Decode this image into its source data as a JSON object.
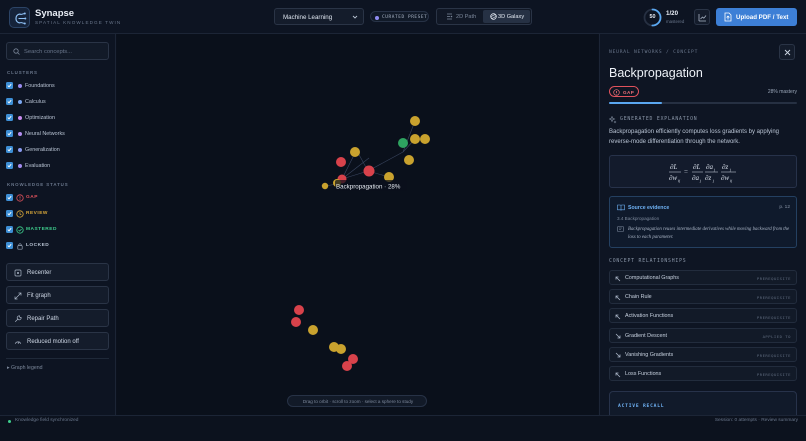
{
  "app": {
    "name": "Synapse",
    "subtitle": "SPATIAL KNOWLEDGE TWIN"
  },
  "header": {
    "dataset_select": "Machine Learning",
    "preset_badge": "CURATED PRESET",
    "view_2d": "2D Path",
    "view_3d": "3D Galaxy",
    "active_view": "3D Galaxy",
    "mastery_ring_value": "50",
    "mastery_ring_fraction": 0.5,
    "progress_count": "1/20",
    "progress_label": "mastered",
    "upload_label": "Upload PDF / Text"
  },
  "sidebar": {
    "search_placeholder": "Search concepts...",
    "clusters_title": "CLUSTERS",
    "clusters": [
      {
        "label": "Foundations",
        "color": "#9a8cf0"
      },
      {
        "label": "Calculus",
        "color": "#7aa7f2"
      },
      {
        "label": "Optimization",
        "color": "#c98cf0"
      },
      {
        "label": "Neural Networks",
        "color": "#b48ef0"
      },
      {
        "label": "Generalization",
        "color": "#8a9af0"
      },
      {
        "label": "Evaluation",
        "color": "#a38cf0"
      }
    ],
    "status_title": "KNOWLEDGE STATUS",
    "statuses": [
      {
        "label": "GAP",
        "color": "#e0525c"
      },
      {
        "label": "REVIEW",
        "color": "#d9a83a"
      },
      {
        "label": "MASTERED",
        "color": "#3ecf8e"
      },
      {
        "label": "LOCKED",
        "color": "#9aa6b8"
      }
    ],
    "actions": [
      {
        "label": "Recenter",
        "icon": "crosshair-icon"
      },
      {
        "label": "Fit graph",
        "icon": "expand-icon"
      },
      {
        "label": "Repair Path",
        "icon": "wrench-icon"
      },
      {
        "label": "Reduced motion off",
        "icon": "motion-icon"
      }
    ],
    "legend_toggle": "▸ Graph legend"
  },
  "graph": {
    "selected_label": "Backpropagation · 28%",
    "hint": "Drag to orbit · scroll to zoom · select a sphere to study",
    "node_colors": {
      "gap": "#d8424b",
      "review": "#c9a22e",
      "mastered": "#2ea360"
    }
  },
  "panel": {
    "breadcrumb": "NEURAL NETWORKS  /  CONCEPT",
    "title": "Backpropagation",
    "status_badge": "GAP",
    "mastery_text": "28% mastery",
    "mastery_fraction": 0.28,
    "generated_title": "GENERATED EXPLANATION",
    "explanation": "Backpropagation efficiently computes loss gradients by applying reverse-mode differentiation through the network.",
    "evidence": {
      "title": "Source evidence",
      "page": "p. 12",
      "section": "3.4 Backpropagation",
      "quote": "Backpropagation reuses intermediate derivatives while moving backward from the loss to each parameter."
    },
    "relationships_title": "CONCEPT RELATIONSHIPS",
    "relationships": [
      {
        "name": "Computational Graphs",
        "type": "PREREQUISITE",
        "dir": "in"
      },
      {
        "name": "Chain Rule",
        "type": "PREREQUISITE",
        "dir": "in"
      },
      {
        "name": "Activation Functions",
        "type": "PREREQUISITE",
        "dir": "in"
      },
      {
        "name": "Gradient Descent",
        "type": "APPLIED TO",
        "dir": "out"
      },
      {
        "name": "Vanishing Gradients",
        "type": "PREREQUISITE",
        "dir": "out"
      },
      {
        "name": "Loss Functions",
        "type": "PREREQUISITE",
        "dir": "in"
      }
    ],
    "active_recall": "ACTIVE RECALL"
  },
  "footer": {
    "sync": "Knowledge field synchronized",
    "session": "Session: 0 attempts · Review summary"
  }
}
